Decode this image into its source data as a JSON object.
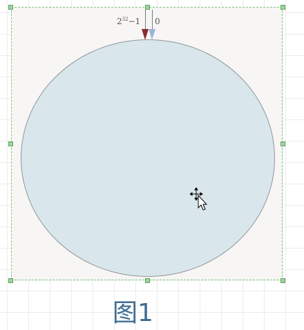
{
  "diagram": {
    "max_label_base": "2",
    "max_label_exp": "32",
    "max_label_suffix": "−1",
    "zero_label": "0",
    "caption": "图1"
  },
  "colors": {
    "circle_fill": "#d9e7ec",
    "selection_border": "#7dc47d",
    "arrow_max": "#8b2b2b",
    "arrow_zero": "#9cb5d8",
    "caption": "#3f6e94"
  },
  "icons": {
    "cursor": "move-cursor-icon"
  }
}
